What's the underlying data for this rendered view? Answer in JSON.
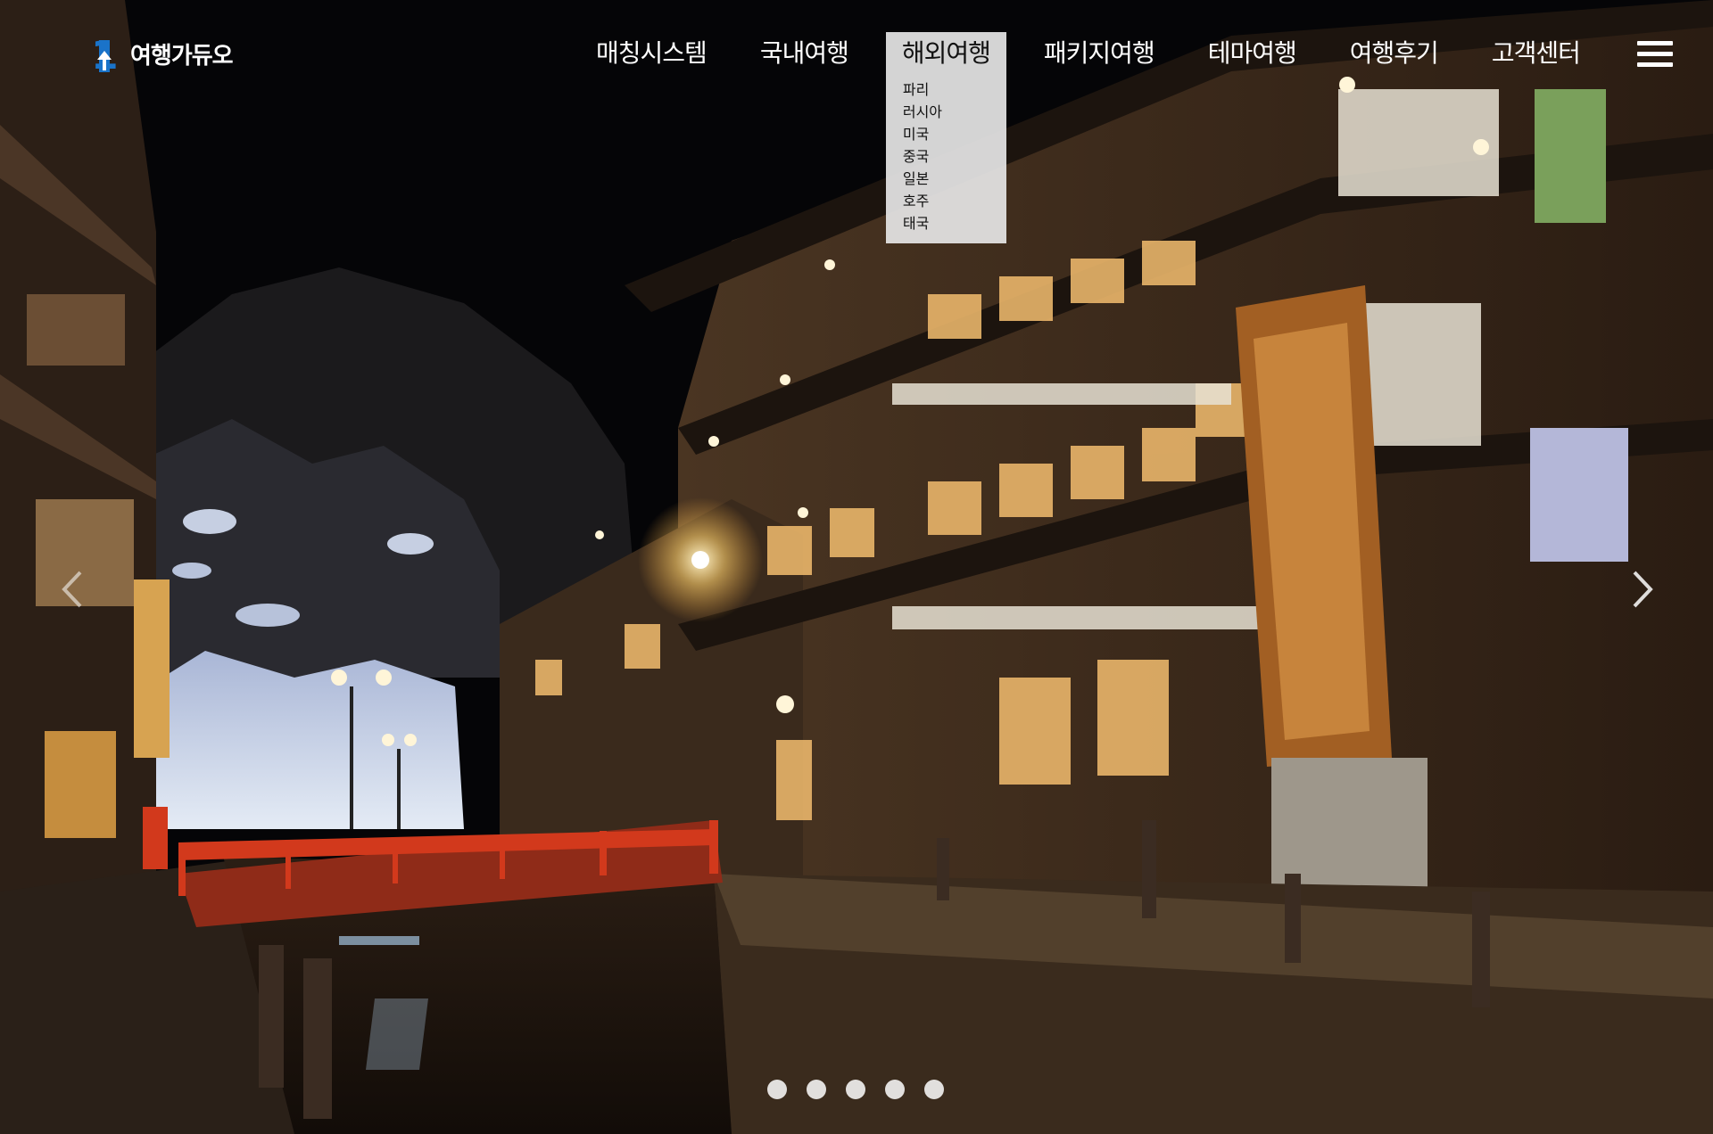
{
  "brand": {
    "name": "여행가듀오",
    "mark": "1",
    "color": "#1a73c9"
  },
  "nav": {
    "items": [
      {
        "label": "매칭시스템"
      },
      {
        "label": "국내여행"
      },
      {
        "label": "해외여행",
        "active": true
      },
      {
        "label": "패키지여행"
      },
      {
        "label": "테마여행"
      },
      {
        "label": "여행후기"
      },
      {
        "label": "고객센터"
      }
    ],
    "dropdown": [
      "파리",
      "러시아",
      "미국",
      "중국",
      "일본",
      "호주",
      "태국"
    ]
  },
  "icons": {
    "menu": "hamburger-menu-icon",
    "prev": "chevron-left-icon",
    "next": "chevron-right-icon"
  },
  "slider": {
    "slide_count": 5,
    "active_index": 0
  },
  "colors": {
    "bridge": "#d2391c",
    "night_sky": "#050507",
    "lamp_glow": "#ffd27a"
  }
}
